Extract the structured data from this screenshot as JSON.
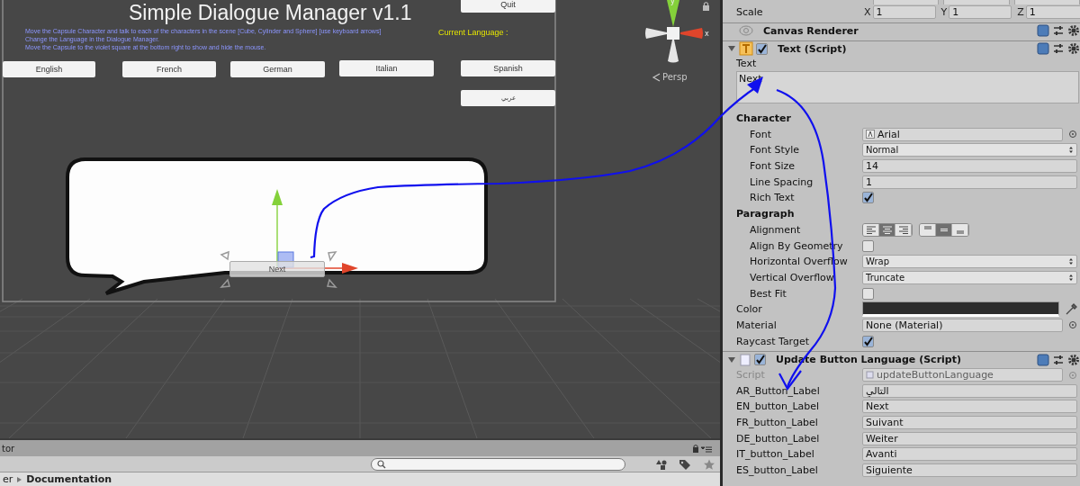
{
  "scene_view": {
    "title": "Simple Dialogue Manager v1.1",
    "instructions": [
      "Move the Capsule Character and talk to each of the characters in the scene [Cube, Cylinder and Sphere] [use keyboard arrows]",
      "Change the Language in the Dialogue Manager.",
      "Move the Capsule to the violet square at the bottom right to show and hide the mouse."
    ],
    "current_language_label": "Current Language :",
    "quit_button": "Quit",
    "language_buttons": [
      "English",
      "French",
      "German",
      "Italian",
      "Spanish",
      "عربي"
    ],
    "gizmo_labels": {
      "y": "y",
      "x": "x"
    },
    "projection_label": "Persp",
    "bubble_button": "Next"
  },
  "project_panel": {
    "tab_label": "tor",
    "breadcrumb": [
      "er",
      "Documentation"
    ]
  },
  "inspector": {
    "scale": {
      "label": "Scale",
      "fields": [
        {
          "axis": "X",
          "value": "1"
        },
        {
          "axis": "Y",
          "value": "1"
        },
        {
          "axis": "Z",
          "value": "1"
        }
      ]
    },
    "canvas_renderer": {
      "title": "Canvas Renderer"
    },
    "text_component": {
      "title": "Text (Script)",
      "enabled": true,
      "text_label": "Text",
      "text_value": "Next",
      "properties": [
        {
          "kind": "section",
          "label": "Character",
          "children": [
            {
              "kind": "asset",
              "label": "Font",
              "value": "Arial"
            },
            {
              "kind": "dropdown",
              "label": "Font Style",
              "value": "Normal"
            },
            {
              "kind": "field",
              "label": "Font Size",
              "value": "14"
            },
            {
              "kind": "field",
              "label": "Line Spacing",
              "value": "1"
            },
            {
              "kind": "checkbox",
              "label": "Rich Text",
              "checked": true
            }
          ]
        },
        {
          "kind": "section",
          "label": "Paragraph",
          "children": [
            {
              "kind": "alignment",
              "label": "Alignment",
              "horizontal": [
                {
                  "selected": false
                },
                {
                  "selected": true
                },
                {
                  "selected": false
                }
              ],
              "vertical": [
                {
                  "selected": false
                },
                {
                  "selected": true
                },
                {
                  "selected": false
                }
              ]
            },
            {
              "kind": "checkbox",
              "label": "Align By Geometry",
              "checked": false
            },
            {
              "kind": "dropdown",
              "label": "Horizontal Overflow",
              "value": "Wrap"
            },
            {
              "kind": "dropdown",
              "label": "Vertical Overflow",
              "value": "Truncate"
            },
            {
              "kind": "checkbox",
              "label": "Best Fit",
              "checked": false
            }
          ]
        },
        {
          "kind": "color",
          "label": "Color",
          "color": "#2d2d2d"
        },
        {
          "kind": "object",
          "label": "Material",
          "value": "None (Material)"
        },
        {
          "kind": "checkbox",
          "label": "Raycast Target",
          "checked": true
        }
      ]
    },
    "update_component": {
      "title": "Update Button Language (Script)",
      "enabled": true,
      "fields": [
        {
          "kind": "script",
          "label": "Script",
          "value": "updateButtonLanguage",
          "disabled": true
        },
        {
          "kind": "field",
          "label": "AR_Button_Label",
          "value": "التالي",
          "disabled": false
        },
        {
          "kind": "field",
          "label": "EN_button_Label",
          "value": "Next",
          "disabled": false
        },
        {
          "kind": "field",
          "label": "FR_button_Label",
          "value": "Suivant",
          "disabled": false
        },
        {
          "kind": "field",
          "label": "DE_button_Label",
          "value": "Weiter",
          "disabled": false
        },
        {
          "kind": "field",
          "label": "IT_button_Label",
          "value": "Avanti",
          "disabled": false
        },
        {
          "kind": "field",
          "label": "ES_button_Label",
          "value": "Siguiente",
          "disabled": false
        }
      ]
    }
  }
}
